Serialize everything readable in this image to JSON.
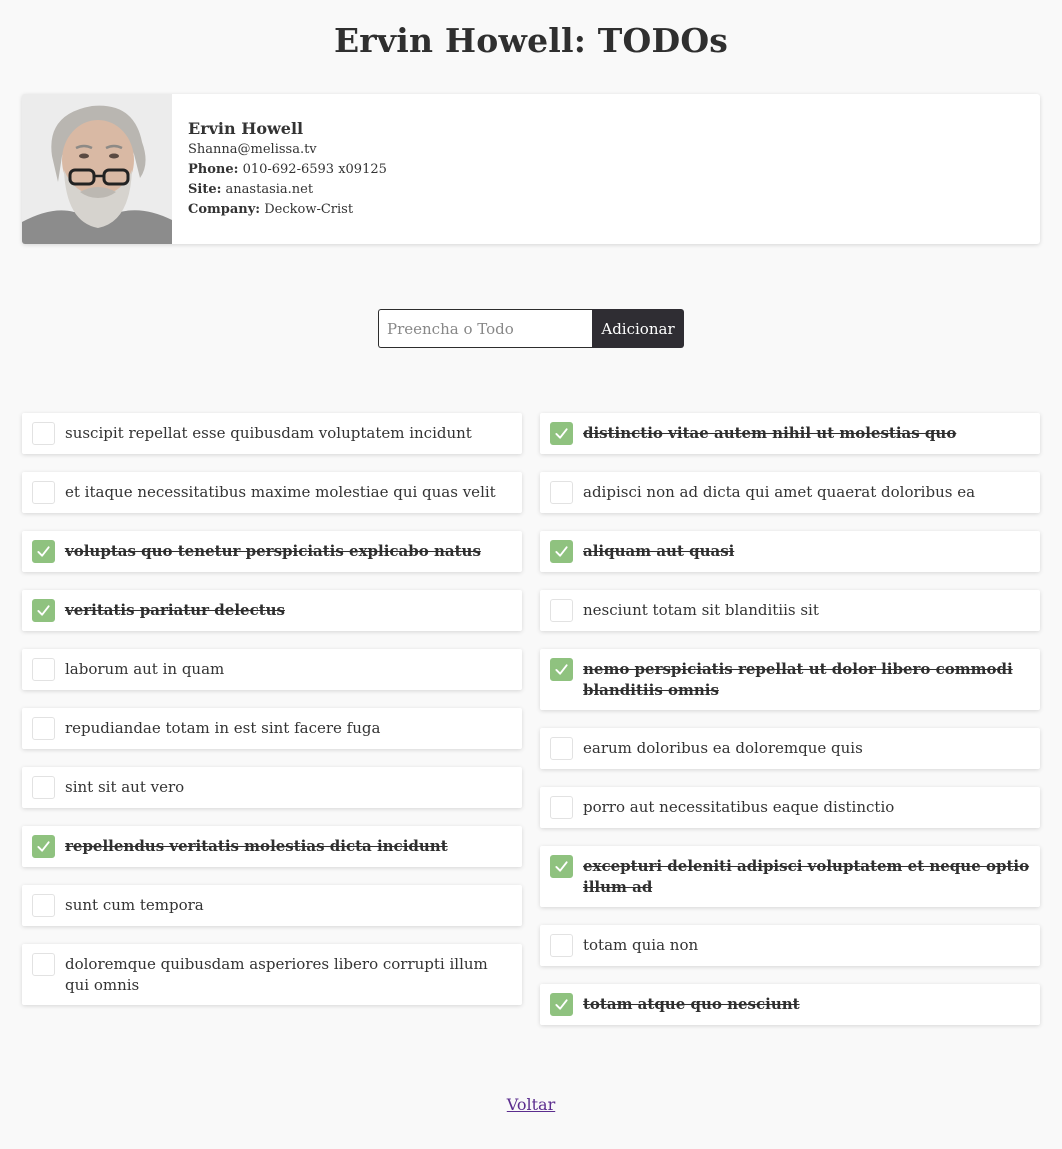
{
  "page": {
    "title": "Ervin Howell: TODOs"
  },
  "profile": {
    "name": "Ervin Howell",
    "email": "Shanna@melissa.tv",
    "phone_label": "Phone:",
    "phone": "010-692-6593 x09125",
    "site_label": "Site:",
    "site": "anastasia.net",
    "company_label": "Company:",
    "company": "Deckow-Crist"
  },
  "form": {
    "placeholder": "Preencha o Todo",
    "value": "",
    "add_label": "Adicionar"
  },
  "todos_left": [
    {
      "text": "suscipit repellat esse quibusdam voluptatem incidunt",
      "completed": false
    },
    {
      "text": "et itaque necessitatibus maxime molestiae qui quas velit",
      "completed": false
    },
    {
      "text": "voluptas quo tenetur perspiciatis explicabo natus",
      "completed": true
    },
    {
      "text": "veritatis pariatur delectus",
      "completed": true
    },
    {
      "text": "laborum aut in quam",
      "completed": false
    },
    {
      "text": "repudiandae totam in est sint facere fuga",
      "completed": false
    },
    {
      "text": "sint sit aut vero",
      "completed": false
    },
    {
      "text": "repellendus veritatis molestias dicta incidunt",
      "completed": true
    },
    {
      "text": "sunt cum tempora",
      "completed": false
    },
    {
      "text": "doloremque quibusdam asperiores libero corrupti illum qui omnis",
      "completed": false
    }
  ],
  "todos_right": [
    {
      "text": "distinctio vitae autem nihil ut molestias quo",
      "completed": true
    },
    {
      "text": "adipisci non ad dicta qui amet quaerat doloribus ea",
      "completed": false
    },
    {
      "text": "aliquam aut quasi",
      "completed": true
    },
    {
      "text": "nesciunt totam sit blanditiis sit",
      "completed": false
    },
    {
      "text": "nemo perspiciatis repellat ut dolor libero commodi blanditiis omnis",
      "completed": true
    },
    {
      "text": "earum doloribus ea doloremque quis",
      "completed": false
    },
    {
      "text": "porro aut necessitatibus eaque distinctio",
      "completed": false
    },
    {
      "text": "excepturi deleniti adipisci voluptatem et neque optio illum ad",
      "completed": true
    },
    {
      "text": "totam quia non",
      "completed": false
    },
    {
      "text": "totam atque quo nesciunt",
      "completed": true
    }
  ],
  "footer": {
    "back_label": "Voltar"
  },
  "colors": {
    "check_green": "#8fc27f",
    "button_dark": "#2f2d33",
    "link_purple": "#5b2d8e"
  },
  "icons": {
    "check": "check-icon"
  }
}
